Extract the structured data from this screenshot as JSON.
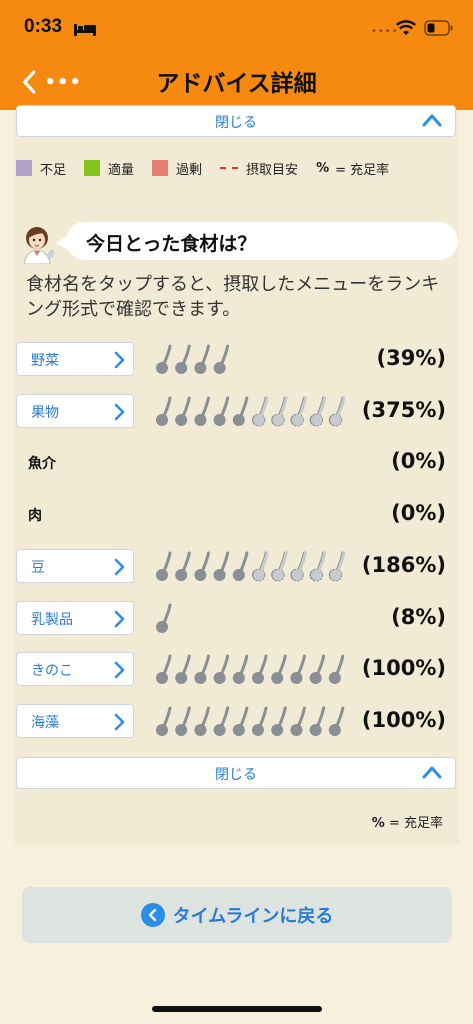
{
  "status_bar": {
    "time": "0:33"
  },
  "nav": {
    "title": "アドバイス詳細",
    "more": "•••"
  },
  "collapse_top": {
    "label": "閉じる"
  },
  "legend": {
    "shortage": "不足",
    "appropriate": "適量",
    "excess": "過剰",
    "target": "摂取目安",
    "pct_symbol": "%",
    "pct_label": "= 充足率",
    "colors": {
      "shortage": "#b0a2c8",
      "appropriate": "#86c31c",
      "excess": "#ea7d73",
      "target": "#e0312f"
    }
  },
  "question": {
    "text": "今日とった食材は？"
  },
  "description": "食材名をタップすると、摂取したメニューをランキング形式で確認できます。",
  "foods": [
    {
      "name": "野菜",
      "tappable": true,
      "percent": "(39%)",
      "spoons": 4,
      "excess_spoons": 0
    },
    {
      "name": "果物",
      "tappable": true,
      "percent": "(375%)",
      "spoons": 10,
      "excess_spoons": 5
    },
    {
      "name": "魚介",
      "tappable": false,
      "percent": "(0%)",
      "spoons": 0,
      "excess_spoons": 0
    },
    {
      "name": "肉",
      "tappable": false,
      "percent": "(0%)",
      "spoons": 0,
      "excess_spoons": 0
    },
    {
      "name": "豆",
      "tappable": true,
      "percent": "(186%)",
      "spoons": 10,
      "excess_spoons": 5
    },
    {
      "name": "乳製品",
      "tappable": true,
      "percent": "(8%)",
      "spoons": 1,
      "excess_spoons": 0
    },
    {
      "name": "きのこ",
      "tappable": true,
      "percent": "(100%)",
      "spoons": 10,
      "excess_spoons": 0
    },
    {
      "name": "海藻",
      "tappable": true,
      "percent": "(100%)",
      "spoons": 10,
      "excess_spoons": 0
    }
  ],
  "collapse_bottom": {
    "label": "閉じる"
  },
  "pct_note": {
    "symbol": "%",
    "label": "= 充足率"
  },
  "back_timeline": {
    "label": "タイムラインに戻る"
  }
}
